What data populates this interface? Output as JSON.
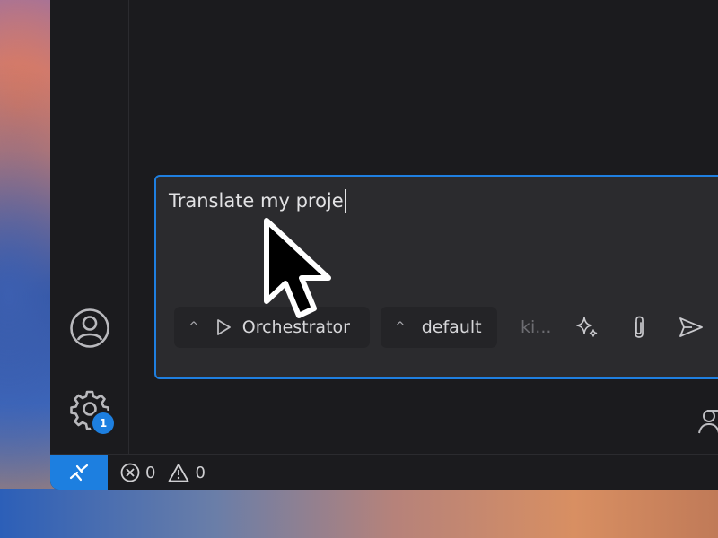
{
  "app": {
    "accent": "#1f7fe0",
    "background": "#1b1b1e"
  },
  "activity_bar": {
    "account_icon": "account-icon",
    "settings_icon": "gear-icon",
    "settings_badge": "1"
  },
  "chat": {
    "input_value": "Translate my proje",
    "agent_selector": {
      "label": "Orchestrator",
      "icon": "play-icon",
      "chevron": "^"
    },
    "mode_selector": {
      "label": "default",
      "chevron": "^"
    },
    "truncated_hint": "ki...",
    "actions": [
      "sparkle-icon",
      "paperclip-icon",
      "send-icon"
    ]
  },
  "status_bar": {
    "remote_icon": "remote-icon",
    "errors_count": "0",
    "warnings_count": "0"
  }
}
